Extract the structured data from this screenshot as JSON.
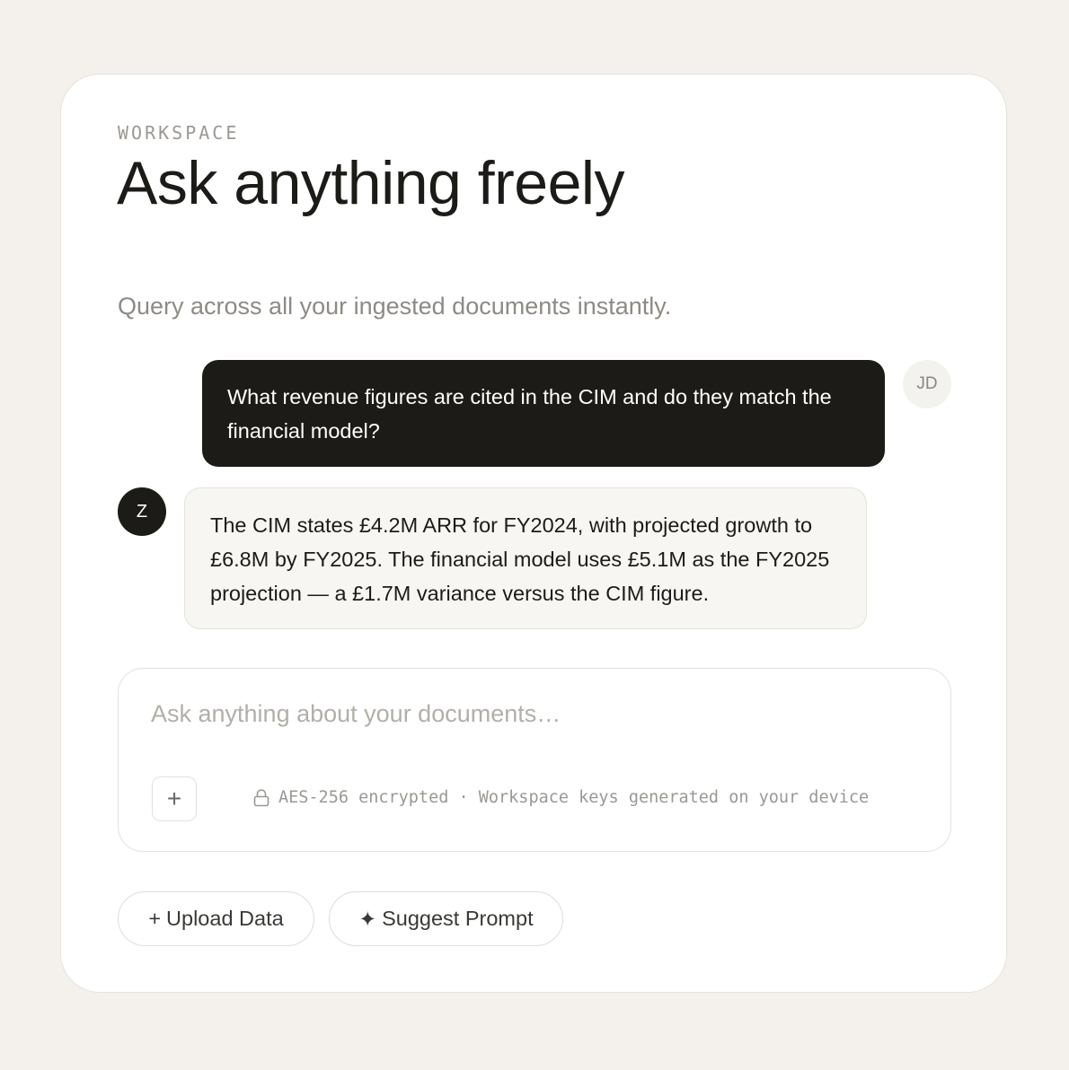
{
  "header": {
    "eyebrow": "WORKSPACE",
    "title": "Ask anything freely",
    "subtitle": "Query across all your ingested documents instantly."
  },
  "conversation": {
    "user": {
      "initials": "JD",
      "message": "What revenue figures are cited in the CIM and do they match the financial model?"
    },
    "assistant": {
      "initial": "Z",
      "message": "The CIM states £4.2M ARR for FY2024, with projected growth to £6.8M by FY2025. The financial model uses £5.1M as the FY2025 projection — a £1.7M variance versus the CIM figure."
    }
  },
  "composer": {
    "placeholder": "Ask anything about your documents…",
    "value": "",
    "attach_label": "+",
    "security_note": "AES-256 encrypted · Workspace keys generated on your device",
    "security_icon": "lock-icon"
  },
  "actions": {
    "upload": {
      "glyph": "+",
      "label": "Upload Data"
    },
    "suggest": {
      "glyph": "✦",
      "label": "Suggest Prompt"
    }
  },
  "colors": {
    "page_background": "#f4f1ec",
    "card_background": "#ffffff",
    "user_bubble": "#1c1b18",
    "assistant_bubble": "#f7f6f3",
    "muted_text": "#8e8a85"
  }
}
